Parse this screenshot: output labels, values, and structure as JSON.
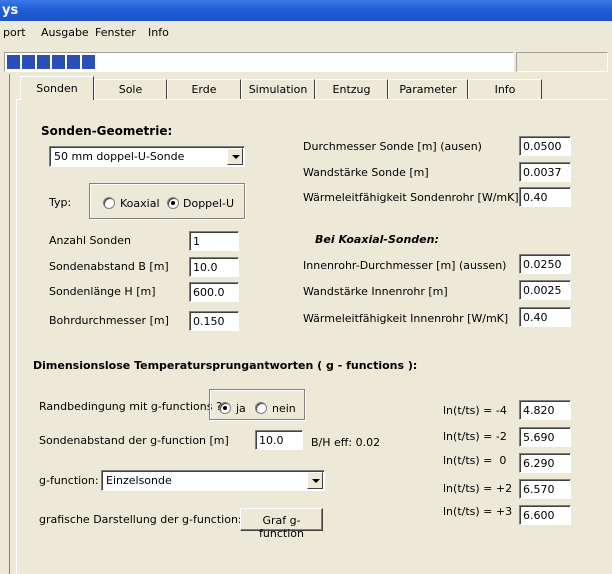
{
  "window": {
    "title": "ys"
  },
  "menu": [
    "port",
    "Ausgabe",
    "Fenster",
    "Info"
  ],
  "tabs": [
    "Sonden",
    "Sole",
    "Erde",
    "Simulation",
    "Entzug",
    "Parameter",
    "Info"
  ],
  "geometry": {
    "heading": "Sonden-Geometrie:",
    "probe_type_select": "50 mm doppel-U-Sonde",
    "typ_label": "Typ:",
    "radio_koaxial": "Koaxial",
    "radio_doppelu": "Doppel-U",
    "anzahl_label": "Anzahl Sonden",
    "anzahl_value": "1",
    "abstand_label": "Sondenabstand B [m]",
    "abstand_value": "10.0",
    "laenge_label": "Sondenlänge H [m]",
    "laenge_value": "600.0",
    "bohr_label": "Bohrdurchmesser [m]",
    "bohr_value": "0.150"
  },
  "pipe": {
    "durchmesser_label": "Durchmesser Sonde [m] (ausen)",
    "durchmesser_value": "0.0500",
    "wandstaerke_label": "Wandstärke Sonde [m]",
    "wandstaerke_value": "0.0037",
    "leitf_label": "Wärmeleitfähigkeit Sondenrohr [W/mK]",
    "leitf_value": "0.40",
    "koaxial_heading": "Bei Koaxial-Sonden:",
    "innen_d_label": "Innenrohr-Durchmesser [m] (aussen)",
    "innen_d_value": "0.0250",
    "innen_w_label": "Wandstärke Innenrohr [m]",
    "innen_w_value": "0.0025",
    "innen_l_label": "Wärmeleitfähigkeit Innenrohr [W/mK]",
    "innen_l_value": "0.40"
  },
  "gfunc": {
    "heading": "Dimensionslose Temperatursprungantworten  ( g - functions ):",
    "rand_label": "Randbedingung mit g-functions ?",
    "radio_ja": "ja",
    "radio_nein": "nein",
    "abstand_label": "Sondenabstand der g-function [m]",
    "abstand_value": "10.0",
    "bh_label": "B/H eff: 0.02",
    "gfunction_label": "g-function:",
    "gfunction_select": "Einzelsonde",
    "graf_label": "grafische Darstellung der g-function:",
    "graf_button": "Graf g-function",
    "ln_rows": [
      {
        "label": "ln(t/ts) = -4",
        "value": "4.820"
      },
      {
        "label": "ln(t/ts) = -2",
        "value": "5.690"
      },
      {
        "label": "ln(t/ts) =  0",
        "value": "6.290"
      },
      {
        "label": "ln(t/ts) = +2",
        "value": "6.570"
      },
      {
        "label": "ln(t/ts) = +3",
        "value": "6.600"
      }
    ]
  },
  "progress": {
    "blocks_filled": 6
  },
  "colors": {
    "titlebar": "#2360d8",
    "face": "#ece9d8",
    "progress_fill": "#2a4fb8"
  }
}
